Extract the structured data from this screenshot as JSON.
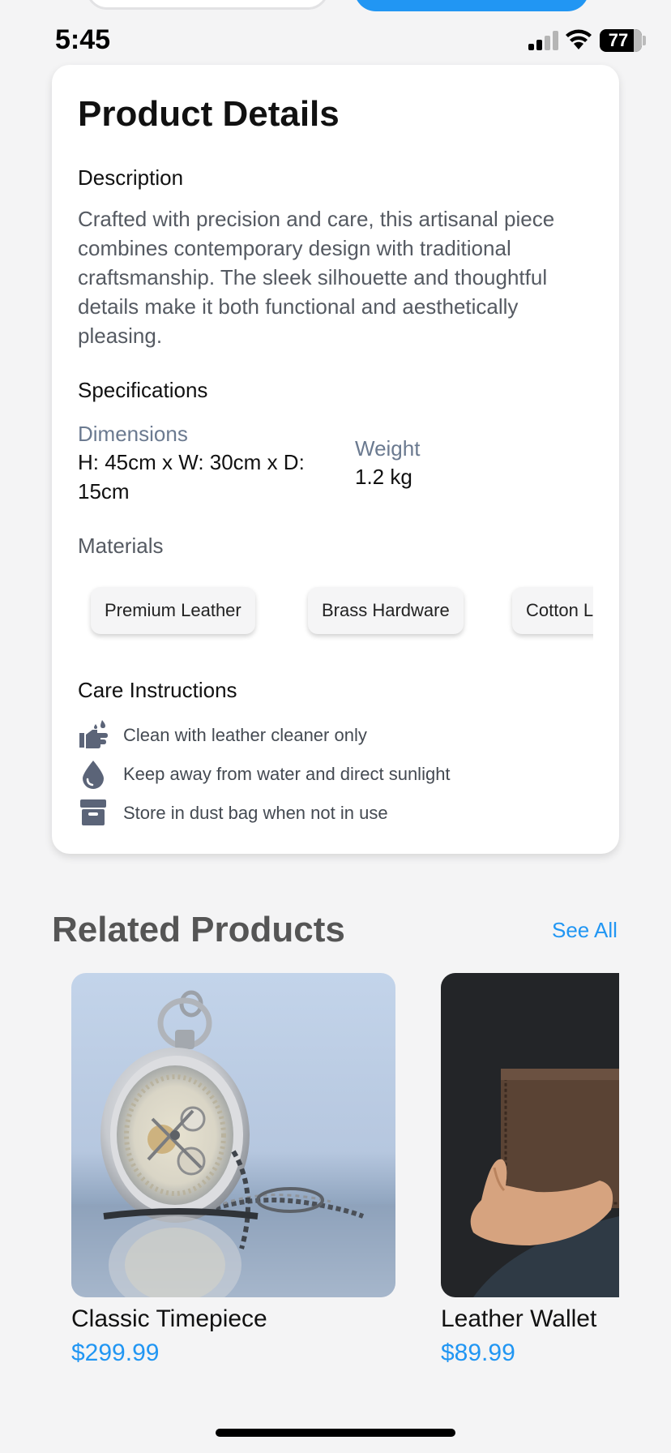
{
  "status_bar": {
    "time": "5:45",
    "battery": "77"
  },
  "product_details": {
    "title": "Product Details",
    "description": {
      "heading": "Description",
      "text": "Crafted with precision and care, this artisanal piece combines contemporary design with traditional craftsmanship. The sleek silhouette and thoughtful details make it both functional and aesthetically pleasing."
    },
    "specifications": {
      "heading": "Specifications",
      "dimensions_label": "Dimensions",
      "dimensions_line1": "H: 45cm x W: 30cm x D:",
      "dimensions_line2": "15cm",
      "weight_label": "Weight",
      "weight_value": "1.2 kg"
    },
    "materials": {
      "heading": "Materials",
      "items": [
        "Premium Leather",
        "Brass Hardware",
        "Cotton Lining"
      ]
    },
    "care": {
      "heading": "Care Instructions",
      "items": [
        {
          "icon": "hand-wash-icon",
          "text": "Clean with leather cleaner only"
        },
        {
          "icon": "water-drop-icon",
          "text": "Keep away from water and direct sunlight"
        },
        {
          "icon": "archive-box-icon",
          "text": "Store in dust bag when not in use"
        }
      ]
    }
  },
  "related": {
    "heading": "Related Products",
    "see_all": "See All",
    "items": [
      {
        "name": "Classic Timepiece",
        "price": "$299.99"
      },
      {
        "name": "Leather Wallet",
        "price": "$89.99"
      }
    ]
  },
  "colors": {
    "accent": "#2196f3",
    "icon": "#5b6478"
  }
}
